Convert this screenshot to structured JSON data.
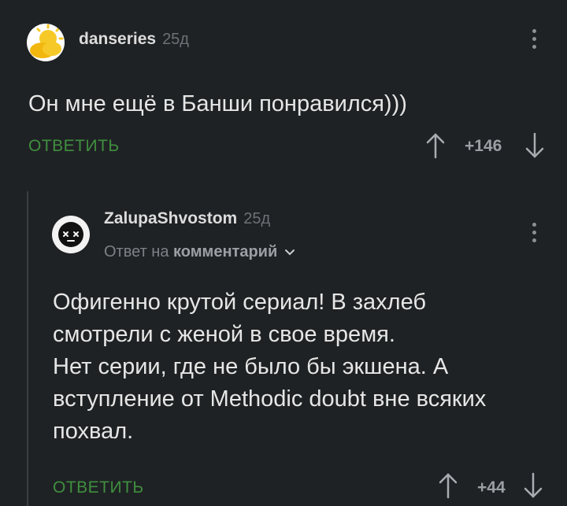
{
  "comment": {
    "username": "danseries",
    "age": "25д",
    "text": "Он мне ещё в Банши понравился)))",
    "reply_label": "ОТВЕТИТЬ",
    "rating": "+146"
  },
  "reply": {
    "username": "ZalupaShvostom",
    "age": "25д",
    "reply_to_prefix": "Ответ на",
    "reply_to_target": "комментарий",
    "text_lines": [
      "Офигенно крутой сериал! В захлеб",
      "смотрели с женой в свое время.",
      "Нет серии, где не было бы экшена. А",
      "вступление от Methodic doubt вне всяких",
      "похвал."
    ],
    "reply_label": "ОТВЕТИТЬ",
    "rating": "+44"
  },
  "icons": {
    "upvote": "arrow-up-icon",
    "downvote": "arrow-down-icon",
    "more": "more-vertical-icon",
    "chevron": "chevron-down-icon"
  },
  "colors": {
    "background": "#1f2224",
    "reply_link": "#3f8f3f",
    "muted": "#7d8286"
  }
}
